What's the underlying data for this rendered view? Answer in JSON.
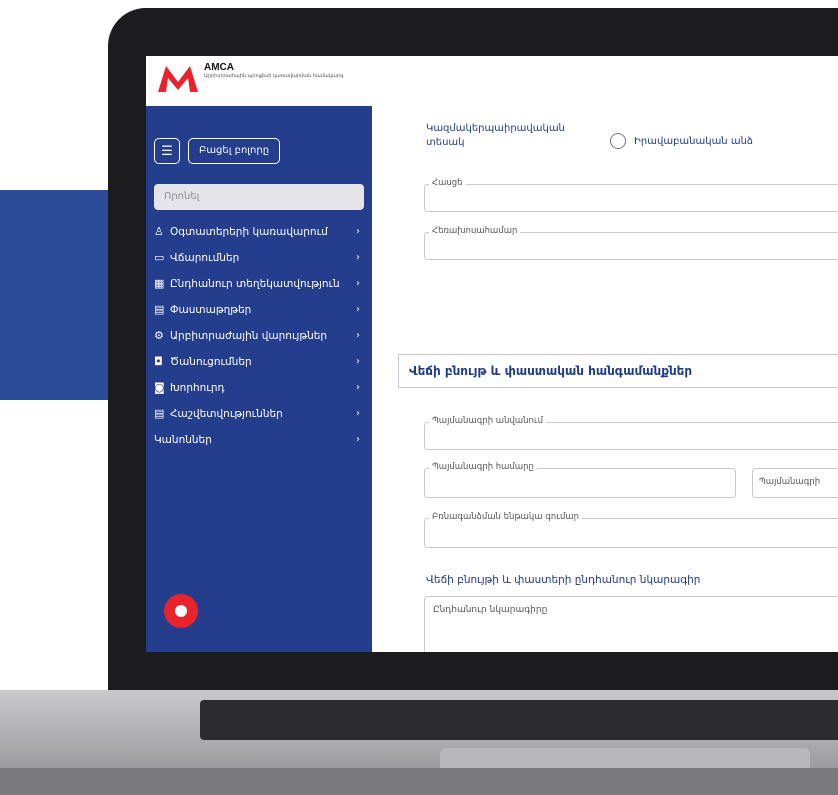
{
  "brand": {
    "title": "AMCA",
    "subtitle": "Արբիտրաժային պրոցեսի կառավարման համակարգ"
  },
  "sidebar": {
    "open_all_label": "Բացել բոլորը",
    "search_placeholder": "Որոնել",
    "items": [
      {
        "label": "Օգտատերերի կառավարում",
        "icon": "user-icon"
      },
      {
        "label": "Վճարումներ",
        "icon": "card-icon"
      },
      {
        "label": "Ընդհանուր տեղեկատվություն",
        "icon": "calendar-icon"
      },
      {
        "label": "Փաստաթղթեր",
        "icon": "clipboard-icon"
      },
      {
        "label": "Արբիտրաժային վարույթներ",
        "icon": "users-gear-icon"
      },
      {
        "label": "Ծանուցումներ",
        "icon": "bell-icon"
      },
      {
        "label": "Խորհուրդ",
        "icon": "bell-outline-icon"
      },
      {
        "label": "Հաշվետվություններ",
        "icon": "clipboard-list-icon"
      },
      {
        "label": "Կանոններ",
        "icon": ""
      }
    ]
  },
  "form": {
    "org_type_label": "Կազմակերպաիրավական տեսակ",
    "radio_label": "Իրավաբանական անձ",
    "address_label": "Հասցե",
    "phone_label": "Հեռախոսահամար",
    "section_title": "Վեճի բնույթ և փաստական հանգամանքներ",
    "contract_name_label": "Պայմանագրի անվանում",
    "contract_number_label": "Պայմանագրի համարը",
    "contract_date_label": "Պայմանագրի",
    "claim_amount_label": "Բռնագանձման ենթակա գումար",
    "desc_heading": "Վեճի բնույթի և փաստերի ընդհանուր նկարագիր",
    "desc_placeholder": "Ընդհանուր նկարագիրը"
  },
  "colors": {
    "sidebar_bg": "#243d8c",
    "accent_red": "#e8232b",
    "text_blue": "#1f3a86"
  }
}
